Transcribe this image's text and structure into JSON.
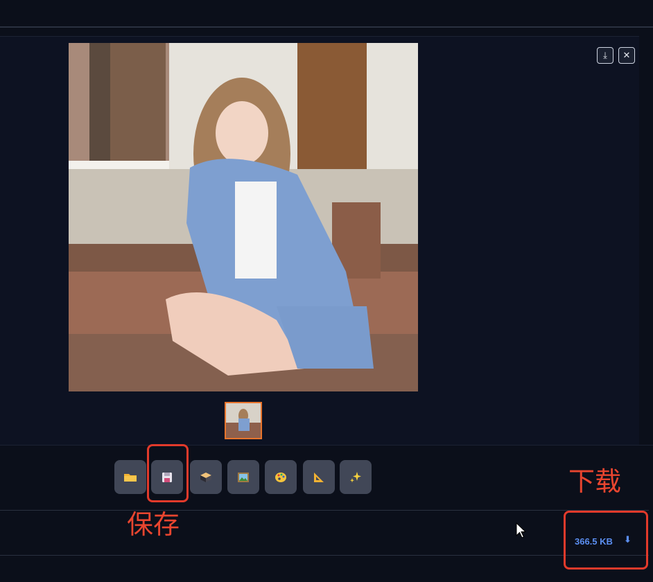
{
  "toolbar": {
    "buttons": [
      {
        "name": "open-folder-button",
        "icon": "folder-icon"
      },
      {
        "name": "save-button",
        "icon": "floppy-disk-icon"
      },
      {
        "name": "zip-button",
        "icon": "package-icon"
      },
      {
        "name": "send-to-img2img-button",
        "icon": "picture-icon"
      },
      {
        "name": "send-to-inpaint-button",
        "icon": "palette-icon"
      },
      {
        "name": "send-to-extras-button",
        "icon": "triangle-ruler-icon"
      },
      {
        "name": "sparkles-button",
        "icon": "sparkles-icon"
      }
    ]
  },
  "panel_icons": {
    "download": "⤓",
    "close": "✕"
  },
  "file": {
    "size": "366.5 KB",
    "download_glyph": "⬇"
  },
  "annotations": {
    "save_label": "保存",
    "download_label": "下载"
  },
  "colors": {
    "accent_orange": "#e8742c",
    "annotation_red": "#e23a2b",
    "link_blue": "#5b8ef0"
  }
}
